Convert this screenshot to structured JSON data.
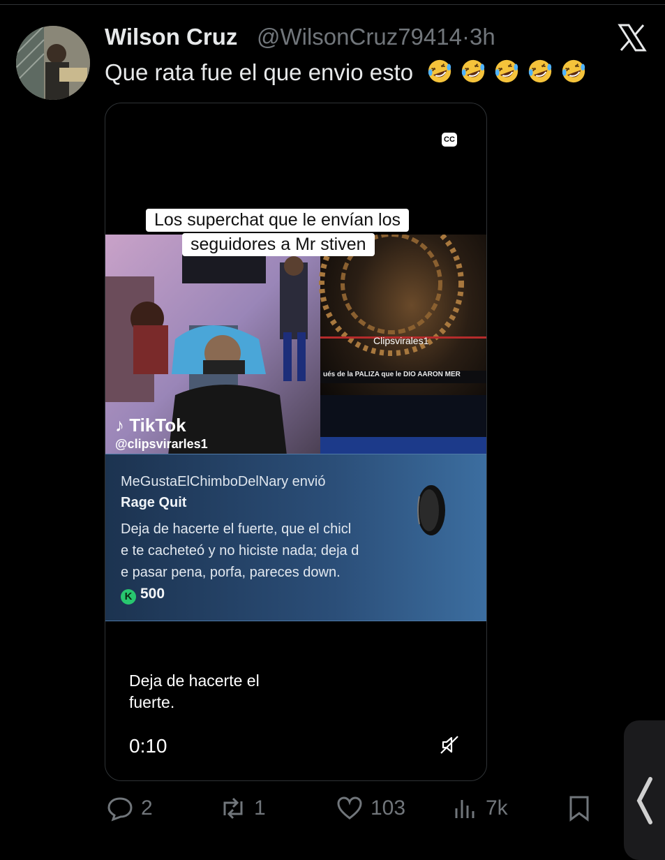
{
  "tweet": {
    "author_name": "Wilson Cruz",
    "author_handle": "@WilsonCruz79414",
    "separator": "·",
    "time": "3h",
    "text": "Que rata fue el que envio esto",
    "emoji_count": 5,
    "emoji_icon": "rolling-on-floor-laughing-emoji"
  },
  "video": {
    "cc_label": "CC",
    "overlay_caption_line1": "Los superchat que le envían los",
    "overlay_caption_line2": "seguidores a Mr stiven",
    "watermark_right": "Clipsvirales1",
    "banner_text": "ués de la PALIZA que le DIO AARON MER",
    "tiktok_label": "TikTok",
    "tiktok_handle": "@clipsvirarles1",
    "superchat": {
      "sender": "MeGustaElChimboDelNary envió",
      "title": "Rage Quit",
      "message_lines": [
        "Deja de hacerte el fuerte, que el chicl",
        "e te cacheteó y no hiciste nada; deja d",
        "e pasar pena, porfa, pareces down."
      ],
      "amount": "500",
      "coin_label": "K"
    },
    "subtitle_line1": "Deja de hacerte el",
    "subtitle_line2": "fuerte.",
    "timestamp": "0:10"
  },
  "actions": {
    "replies": "2",
    "reposts": "1",
    "likes": "103",
    "views": "7k"
  },
  "colors": {
    "background": "#000000",
    "primary_text": "#e7e9ea",
    "secondary_text": "#71767b",
    "superchat_bg": "#2b4e78"
  }
}
